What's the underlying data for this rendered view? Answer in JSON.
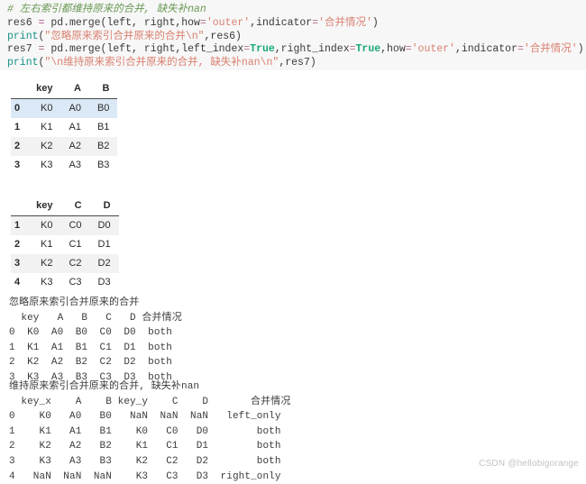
{
  "code_block": {
    "background": "#f7f7f7",
    "lines": [
      [
        {
          "t": "# 左右索引都维持原来的合并, 缺失补nan",
          "c": "comment"
        }
      ],
      [
        {
          "t": "res6 ",
          "c": "name"
        },
        {
          "t": "= ",
          "c": "op"
        },
        {
          "t": "pd.merge(left, right,how",
          "c": "plain"
        },
        {
          "t": "=",
          "c": "eq"
        },
        {
          "t": "'outer'",
          "c": "str"
        },
        {
          "t": ",indicator",
          "c": "plain"
        },
        {
          "t": "=",
          "c": "eq"
        },
        {
          "t": "'合并情况'",
          "c": "str"
        },
        {
          "t": ")",
          "c": "plain"
        }
      ],
      [
        {
          "t": "print",
          "c": "func"
        },
        {
          "t": "(",
          "c": "plain"
        },
        {
          "t": "\"忽略原来索引合并原来的合并\\n\"",
          "c": "str"
        },
        {
          "t": ",res6)",
          "c": "plain"
        }
      ],
      [
        {
          "t": "res7 ",
          "c": "name"
        },
        {
          "t": "= ",
          "c": "op"
        },
        {
          "t": "pd.merge(left, right,left_index",
          "c": "plain"
        },
        {
          "t": "=",
          "c": "eq"
        },
        {
          "t": "True",
          "c": "kw"
        },
        {
          "t": ",right_index",
          "c": "plain"
        },
        {
          "t": "=",
          "c": "eq"
        },
        {
          "t": "True",
          "c": "kw"
        },
        {
          "t": ",how",
          "c": "plain"
        },
        {
          "t": "=",
          "c": "eq"
        },
        {
          "t": "'outer'",
          "c": "str"
        },
        {
          "t": ",indicator",
          "c": "plain"
        },
        {
          "t": "=",
          "c": "eq"
        },
        {
          "t": "'合并情况'",
          "c": "str"
        },
        {
          "t": ")",
          "c": "plain"
        }
      ],
      [
        {
          "t": "print",
          "c": "func"
        },
        {
          "t": "(",
          "c": "plain"
        },
        {
          "t": "\"\\n维持原来索引合并原来的合并, 缺失补nan\\n\"",
          "c": "str"
        },
        {
          "t": ",res7)",
          "c": "plain"
        }
      ]
    ]
  },
  "table_left": {
    "name": "left-dataframe",
    "columns": [
      "",
      "key",
      "A",
      "B"
    ],
    "rows": [
      {
        "index": "0",
        "cells": [
          "K0",
          "A0",
          "B0"
        ],
        "style": "row-hl"
      },
      {
        "index": "1",
        "cells": [
          "K1",
          "A1",
          "B1"
        ],
        "style": ""
      },
      {
        "index": "2",
        "cells": [
          "K2",
          "A2",
          "B2"
        ],
        "style": "row-alt"
      },
      {
        "index": "3",
        "cells": [
          "K3",
          "A3",
          "B3"
        ],
        "style": ""
      }
    ]
  },
  "table_right": {
    "name": "right-dataframe",
    "columns": [
      "",
      "key",
      "C",
      "D"
    ],
    "rows": [
      {
        "index": "1",
        "cells": [
          "K0",
          "C0",
          "D0"
        ],
        "style": "row-alt"
      },
      {
        "index": "2",
        "cells": [
          "K1",
          "C1",
          "D1"
        ],
        "style": ""
      },
      {
        "index": "3",
        "cells": [
          "K2",
          "C2",
          "D2"
        ],
        "style": "row-alt"
      },
      {
        "index": "4",
        "cells": [
          "K3",
          "C3",
          "D3"
        ],
        "style": ""
      }
    ]
  },
  "output_1": {
    "title": "忽略原来索引合并原来的合并",
    "text": "忽略原来索引合并原来的合并\n  key   A   B   C   D 合并情况\n0  K0  A0  B0  C0  D0  both\n1  K1  A1  B1  C1  D1  both\n2  K2  A2  B2  C2  D2  both\n3  K3  A3  B3  C3  D3  both"
  },
  "output_2": {
    "title": "维持原来索引合并原来的合并, 缺失补nan",
    "text": "维持原来索引合并原来的合并, 缺失补nan\n  key_x    A    B key_y    C    D       合并情况\n0    K0   A0   B0   NaN  NaN  NaN   left_only\n1    K1   A1   B1    K0   C0   D0        both\n2    K2   A2   B2    K1   C1   D1        both\n3    K3   A3   B3    K2   C2   D2        both\n4   NaN  NaN  NaN    K3   C3   D3  right_only"
  },
  "watermark": {
    "text": "CSDN @hellobigorange"
  }
}
